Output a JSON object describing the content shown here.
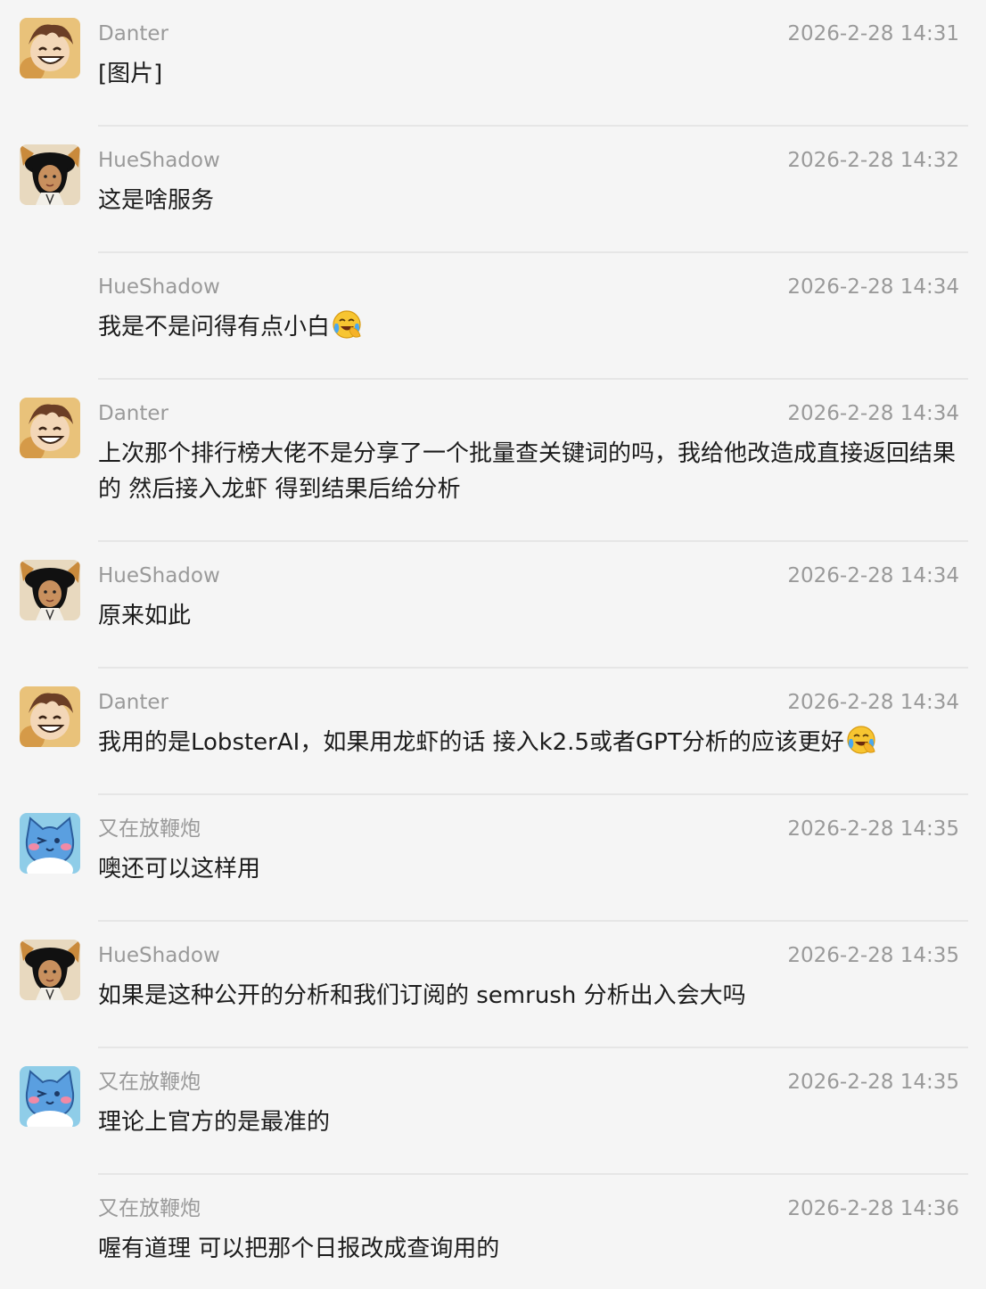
{
  "messages": [
    {
      "sender": "Danter",
      "time": "2026-2-28 14:31",
      "text": "[图片]",
      "avatar": "danter-avatar",
      "show_avatar": true,
      "emoji": ""
    },
    {
      "sender": "HueShadow",
      "time": "2026-2-28 14:32",
      "text": "这是啥服务",
      "avatar": "hueshadow-avatar",
      "show_avatar": true,
      "emoji": ""
    },
    {
      "sender": "HueShadow",
      "time": "2026-2-28 14:34",
      "text": "我是不是问得有点小白",
      "avatar": "",
      "show_avatar": false,
      "emoji": "laughing-crying-emoji"
    },
    {
      "sender": "Danter",
      "time": "2026-2-28 14:34",
      "text": "上次那个排行榜大佬不是分享了一个批量查关键词的吗，我给他改造成直接返回结果的 然后接入龙虾 得到结果后给分析",
      "avatar": "danter-avatar",
      "show_avatar": true,
      "emoji": ""
    },
    {
      "sender": "HueShadow",
      "time": "2026-2-28 14:34",
      "text": "原来如此",
      "avatar": "hueshadow-avatar",
      "show_avatar": true,
      "emoji": ""
    },
    {
      "sender": "Danter",
      "time": "2026-2-28 14:34",
      "text": "我用的是LobsterAI，如果用龙虾的话 接入k2.5或者GPT分析的应该更好",
      "avatar": "danter-avatar",
      "show_avatar": true,
      "emoji": "laughing-crying-emoji"
    },
    {
      "sender": "又在放鞭炮",
      "time": "2026-2-28 14:35",
      "text": "噢还可以这样用",
      "avatar": "blue-cat-avatar",
      "show_avatar": true,
      "emoji": ""
    },
    {
      "sender": "HueShadow",
      "time": "2026-2-28 14:35",
      "text": "如果是这种公开的分析和我们订阅的 semrush 分析出入会大吗",
      "avatar": "hueshadow-avatar",
      "show_avatar": true,
      "emoji": ""
    },
    {
      "sender": "又在放鞭炮",
      "time": "2026-2-28 14:35",
      "text": "理论上官方的是最准的",
      "avatar": "blue-cat-avatar",
      "show_avatar": true,
      "emoji": ""
    },
    {
      "sender": "又在放鞭炮",
      "time": "2026-2-28 14:36",
      "text": "喔有道理 可以把那个日报改成查询用的",
      "avatar": "",
      "show_avatar": false,
      "emoji": ""
    }
  ],
  "colors": {
    "background": "#f5f5f5",
    "meta_text": "#9a9a9a",
    "body_text": "#1c1c1c",
    "divider": "#e6e6e6"
  }
}
